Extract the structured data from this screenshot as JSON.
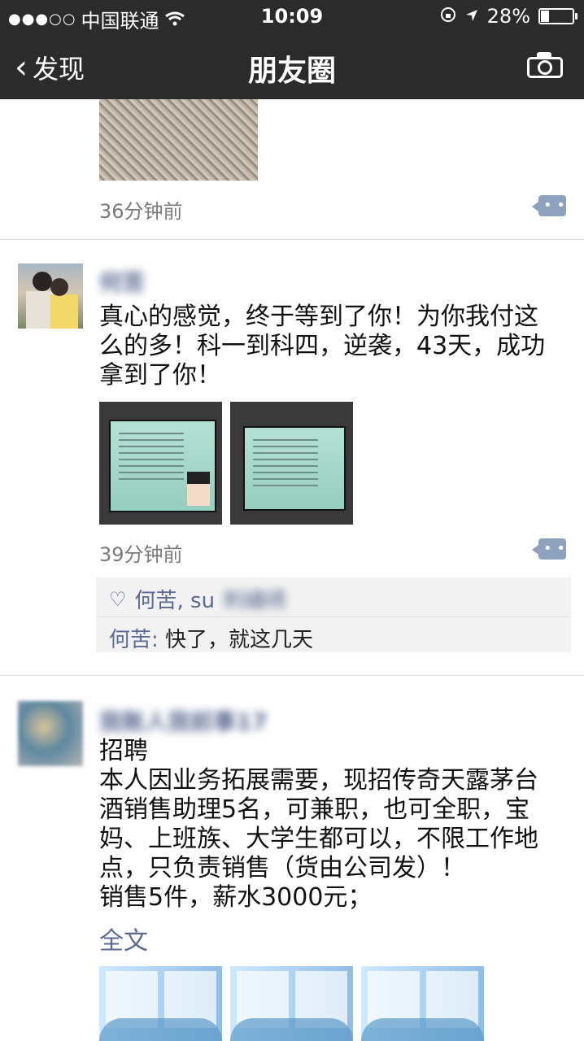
{
  "status": {
    "carrier": "中国联通",
    "time": "10:09",
    "battery": "28%",
    "signal": "●●●○○"
  },
  "nav": {
    "back": "发现",
    "title": "朋友圈"
  },
  "posts": [
    {
      "time": "36分钟前"
    },
    {
      "username": "何苦",
      "text_lines": [
        "真心的感觉，终于等到了你！为你我付这",
        "么的多！科一到科四，逆袭，43天，成功",
        "拿到了你！"
      ],
      "time": "39分钟前",
      "likes": "何苦, su",
      "likes_more": "刺繡绣",
      "comment_name": "何苦:",
      "comment_text": "快了，就这几天"
    },
    {
      "username": "我账人我前事17",
      "text_lines": [
        "招聘",
        "本人因业务拓展需要，现招传奇天露茅台",
        "酒销售助理5名，可兼职，也可全职，宝",
        "妈、上班族、大学生都可以，不限工作地",
        "点，只负责销售（货由公司发）！",
        "销售5件，薪水3000元；"
      ],
      "fulltext": "全文"
    }
  ],
  "icons": {
    "back": "chevron-left-icon",
    "camera": "camera-icon",
    "comment": "comment-icon",
    "like": "heart-icon",
    "wifi": "wifi-icon",
    "location": "location-arrow-icon",
    "lock": "rotation-lock-icon",
    "battery": "battery-icon"
  }
}
